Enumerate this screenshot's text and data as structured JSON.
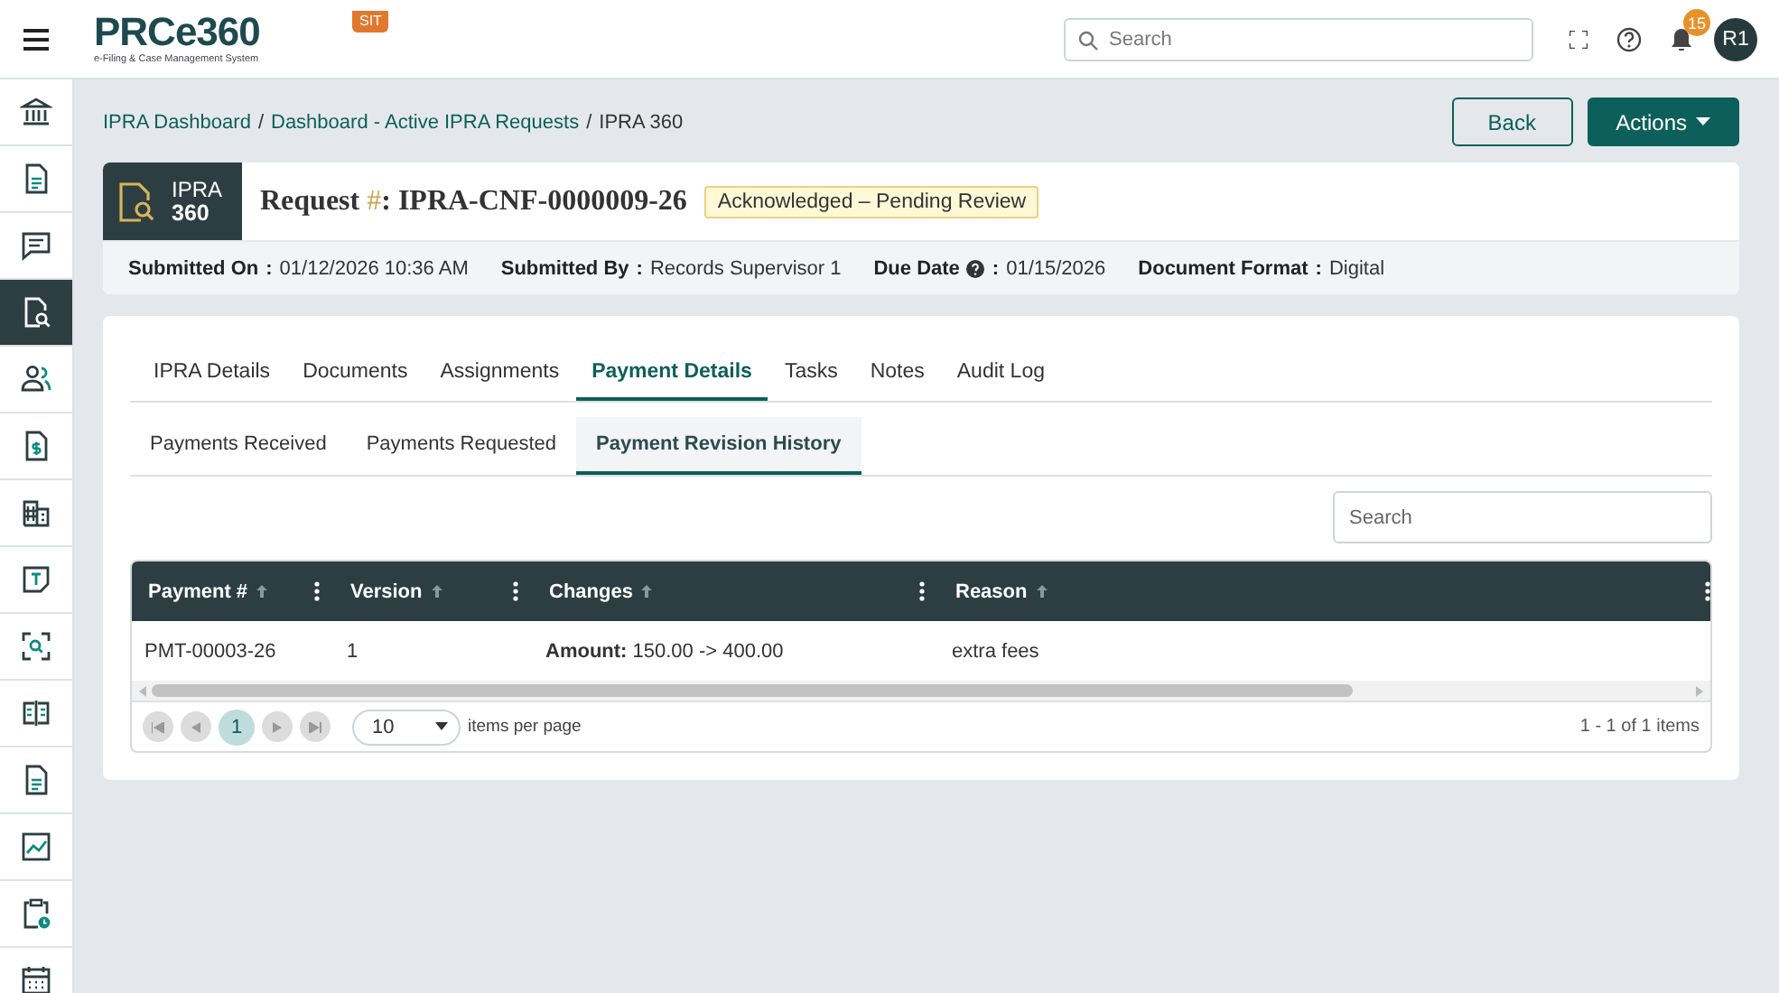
{
  "header": {
    "logo": {
      "name": "PRCe360",
      "tagline": "e-Filing & Case Management System"
    },
    "environment_badge": "SIT",
    "search": {
      "placeholder": "Search"
    },
    "notifications": {
      "count": "15"
    },
    "avatar": "R1"
  },
  "sidebar": {
    "items": [
      {
        "kind": "bank",
        "selected": false
      },
      {
        "kind": "document",
        "selected": false
      },
      {
        "kind": "chat",
        "selected": false
      },
      {
        "kind": "docsearch",
        "selected": true
      },
      {
        "kind": "users",
        "selected": false
      },
      {
        "kind": "invoice",
        "selected": false
      },
      {
        "kind": "building",
        "selected": false
      },
      {
        "kind": "note",
        "selected": false
      },
      {
        "kind": "scan",
        "selected": false
      },
      {
        "kind": "book",
        "selected": false
      },
      {
        "kind": "document",
        "selected": false
      },
      {
        "kind": "chart",
        "selected": false
      },
      {
        "kind": "clipboard",
        "selected": false
      },
      {
        "kind": "calendar",
        "selected": false
      }
    ]
  },
  "breadcrumb": {
    "separator": "/",
    "items": [
      {
        "label": "IPRA Dashboard",
        "link": true
      },
      {
        "label": "Dashboard - Active IPRA Requests",
        "link": true
      },
      {
        "label": "IPRA 360",
        "link": false
      }
    ]
  },
  "buttons": [
    {
      "label": "Back",
      "kind": "outline"
    },
    {
      "label": "Actions",
      "kind": "dropdown"
    }
  ],
  "request": {
    "module": {
      "line1": "IPRA",
      "line2": "360"
    },
    "label": "Request",
    "hash": "#",
    "separator": ":",
    "number": "IPRA-CNF-0000009-26",
    "status": "Acknowledged – Pending Review",
    "field_separator": ":",
    "fields": [
      {
        "label": "Submitted On",
        "value": "01/12/2026 10:36 AM",
        "kind": "plain"
      },
      {
        "label": "Submitted By",
        "value": "Records Supervisor 1",
        "kind": "plain"
      },
      {
        "label": "Due Date",
        "value": "01/15/2026",
        "kind": "info"
      },
      {
        "label": "Document Format",
        "value": "Digital",
        "kind": "plain"
      }
    ]
  },
  "tabs": [
    {
      "label": "IPRA Details",
      "selected": false
    },
    {
      "label": "Documents",
      "selected": false
    },
    {
      "label": "Assignments",
      "selected": false
    },
    {
      "label": "Payment Details",
      "selected": true
    },
    {
      "label": "Tasks",
      "selected": false
    },
    {
      "label": "Notes",
      "selected": false
    },
    {
      "label": "Audit Log",
      "selected": false
    }
  ],
  "subtabs": [
    {
      "label": "Payments Received",
      "selected": false
    },
    {
      "label": "Payments Requested",
      "selected": false
    },
    {
      "label": "Payment Revision History",
      "selected": true
    }
  ],
  "grid": {
    "search": {
      "placeholder": "Search"
    },
    "columns": [
      "Payment #",
      "Version",
      "Changes",
      "Reason"
    ],
    "rows": [
      [
        "PMT-00003-26",
        "1",
        "**Amount:** 150.00 -> 400.00",
        "extra fees"
      ]
    ],
    "pager": {
      "pages": [
        {
          "label": "1",
          "selected": true
        }
      ],
      "page_size": "10",
      "page_size_label": "items per page",
      "summary": "1 - 1 of 1 items"
    }
  }
}
